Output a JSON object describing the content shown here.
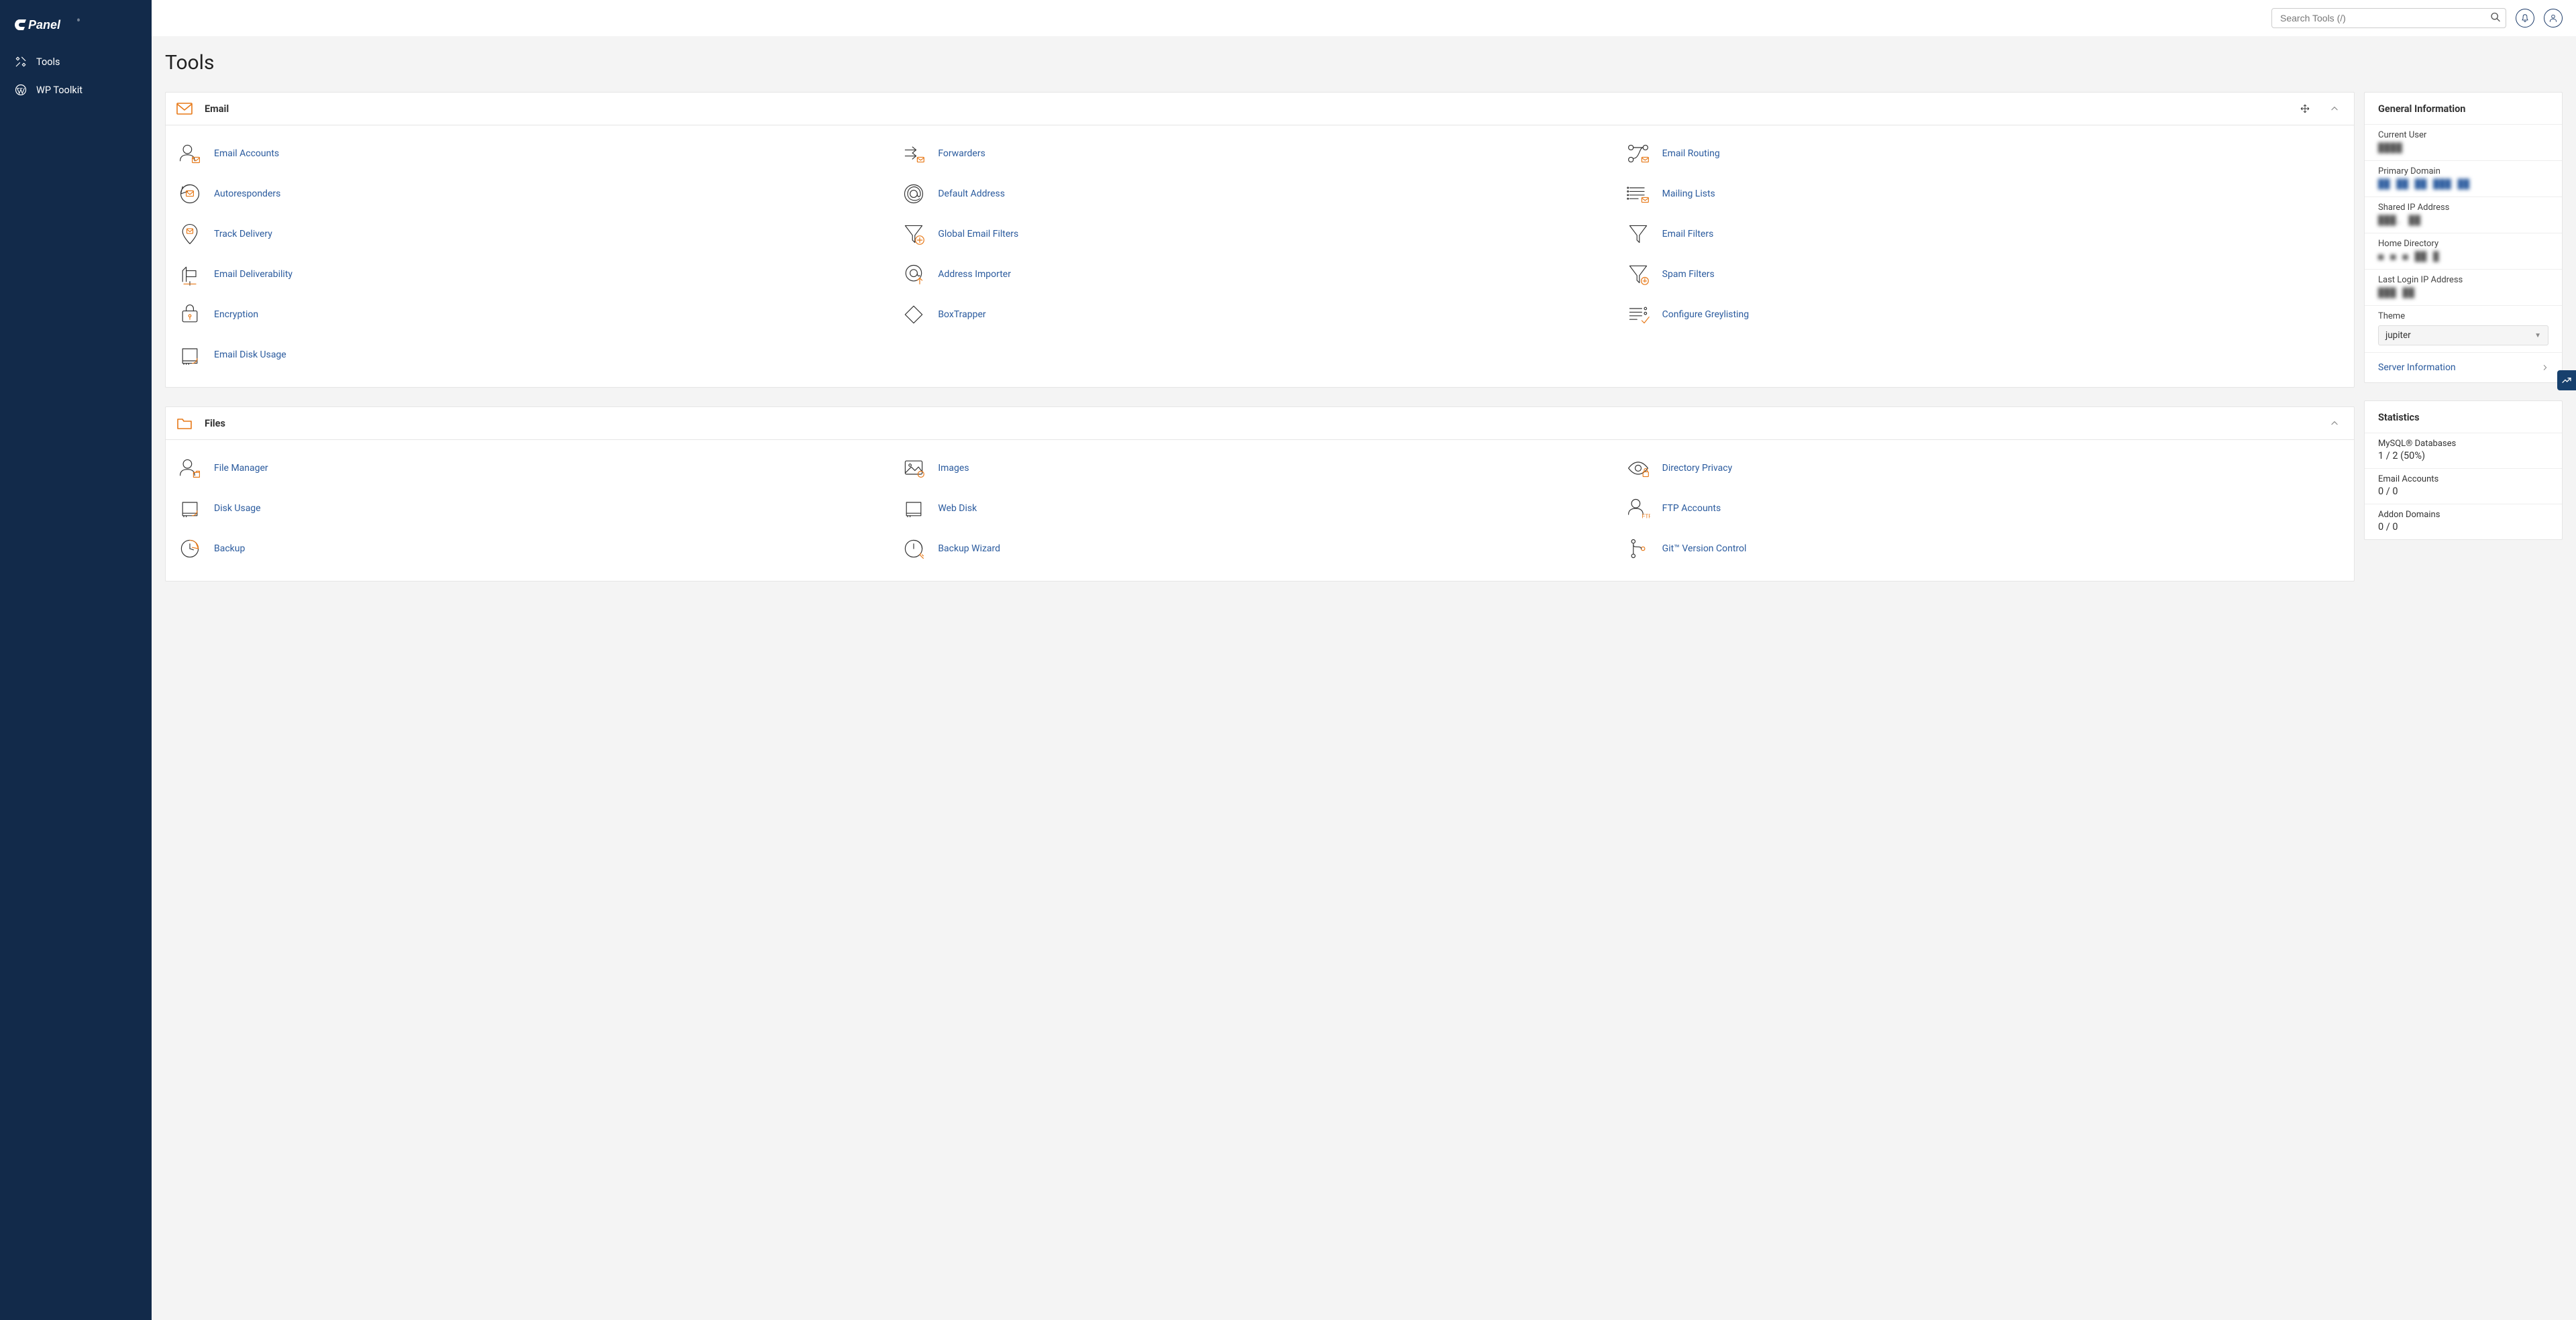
{
  "app": {
    "logo_text": "cPanel"
  },
  "nav": {
    "items": [
      {
        "label": "Tools"
      },
      {
        "label": "WP Toolkit"
      }
    ]
  },
  "header": {
    "search_placeholder": "Search Tools (/)"
  },
  "page": {
    "title": "Tools"
  },
  "sections": [
    {
      "title": "Email",
      "items": [
        "Email Accounts",
        "Forwarders",
        "Email Routing",
        "Autoresponders",
        "Default Address",
        "Mailing Lists",
        "Track Delivery",
        "Global Email Filters",
        "Email Filters",
        "Email Deliverability",
        "Address Importer",
        "Spam Filters",
        "Encryption",
        "BoxTrapper",
        "Configure Greylisting",
        "Email Disk Usage"
      ]
    },
    {
      "title": "Files",
      "items": [
        "File Manager",
        "Images",
        "Directory Privacy",
        "Disk Usage",
        "Web Disk",
        "FTP Accounts",
        "Backup",
        "Backup Wizard",
        "Git™ Version Control"
      ]
    }
  ],
  "general_info": {
    "title": "General Information",
    "current_user_label": "Current User",
    "current_user_value": "████",
    "primary_domain_label": "Primary Domain",
    "primary_domain_value": "██ ██ ██ ███ ██",
    "shared_ip_label": "Shared IP Address",
    "shared_ip_value": "███.  ██",
    "home_dir_label": "Home Directory",
    "home_dir_value": "■ ■ ■ ██ █",
    "last_login_label": "Last Login IP Address",
    "last_login_value": "███ ██",
    "theme_label": "Theme",
    "theme_value": "jupiter",
    "server_info_label": "Server Information"
  },
  "statistics": {
    "title": "Statistics",
    "rows": [
      {
        "label": "MySQL® Databases",
        "value": "1 / 2   (50%)"
      },
      {
        "label": "Email Accounts",
        "value": "0 / 0"
      },
      {
        "label": "Addon Domains",
        "value": "0 / 0"
      }
    ]
  }
}
